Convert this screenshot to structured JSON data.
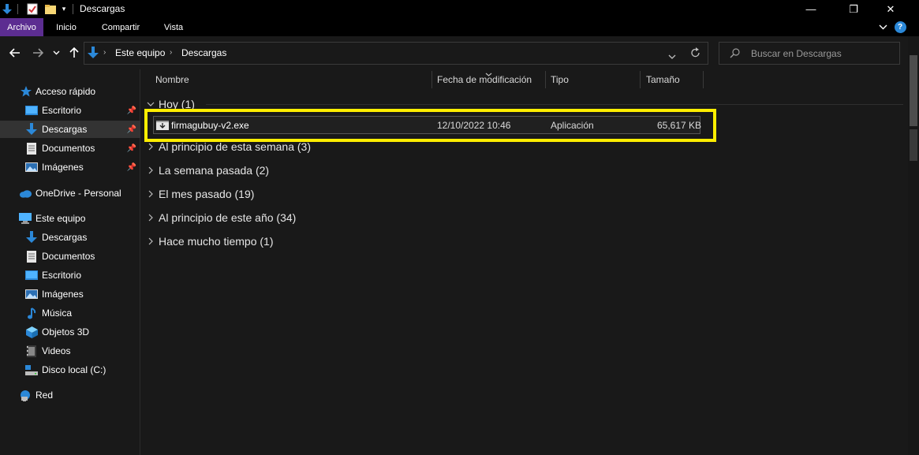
{
  "window": {
    "title": "Descargas",
    "controls": {
      "minimize": "—",
      "restore": "❐",
      "close": "✕"
    }
  },
  "ribbon": {
    "tabs": [
      {
        "label": "Archivo",
        "active": true
      },
      {
        "label": "Inicio",
        "active": false
      },
      {
        "label": "Compartir",
        "active": false
      },
      {
        "label": "Vista",
        "active": false
      }
    ],
    "help": "?"
  },
  "address": {
    "segments": [
      "Este equipo",
      "Descargas"
    ]
  },
  "search": {
    "placeholder": "Buscar en Descargas"
  },
  "sidebar": {
    "quick_access": {
      "label": "Acceso rápido",
      "items": [
        {
          "label": "Escritorio",
          "icon": "desktop-icon",
          "pinned": true
        },
        {
          "label": "Descargas",
          "icon": "download-icon",
          "pinned": true,
          "selected": true
        },
        {
          "label": "Documentos",
          "icon": "document-icon",
          "pinned": true
        },
        {
          "label": "Imágenes",
          "icon": "pictures-icon",
          "pinned": true
        }
      ]
    },
    "onedrive": {
      "label": "OneDrive - Personal",
      "icon": "cloud-icon"
    },
    "this_pc": {
      "label": "Este equipo",
      "items": [
        {
          "label": "Descargas",
          "icon": "download-icon"
        },
        {
          "label": "Documentos",
          "icon": "document-icon"
        },
        {
          "label": "Escritorio",
          "icon": "desktop-icon"
        },
        {
          "label": "Imágenes",
          "icon": "pictures-icon"
        },
        {
          "label": "Música",
          "icon": "music-icon"
        },
        {
          "label": "Objetos 3D",
          "icon": "cube-icon"
        },
        {
          "label": "Videos",
          "icon": "video-icon"
        },
        {
          "label": "Disco local (C:)",
          "icon": "drive-icon"
        }
      ]
    },
    "network": {
      "label": "Red",
      "icon": "network-icon"
    }
  },
  "columns": {
    "name": "Nombre",
    "modified": "Fecha de modificación",
    "type": "Tipo",
    "size": "Tamaño"
  },
  "groups": [
    {
      "label": "Hoy (1)",
      "expanded": true,
      "files": [
        {
          "name": "firmagubuy-v2.exe",
          "modified": "12/10/2022 10:46",
          "type": "Aplicación",
          "size": "65,617 KB"
        }
      ]
    },
    {
      "label": "Al principio de esta semana (3)",
      "expanded": false
    },
    {
      "label": "La semana pasada (2)",
      "expanded": false
    },
    {
      "label": "El mes pasado (19)",
      "expanded": false
    },
    {
      "label": "Al principio de este año (34)",
      "expanded": false
    },
    {
      "label": "Hace mucho tiempo (1)",
      "expanded": false
    }
  ],
  "colors": {
    "accent": "#5c2d91",
    "highlight": "#ffee00",
    "folder_blue": "#2b88d8"
  }
}
